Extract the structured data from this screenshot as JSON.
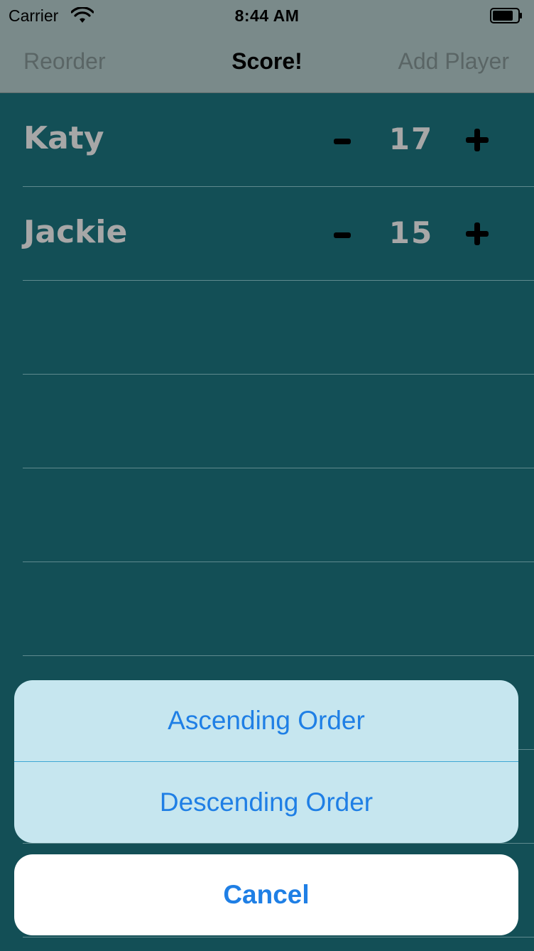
{
  "status_bar": {
    "carrier": "Carrier",
    "time": "8:44 AM",
    "icons": [
      "wifi-icon",
      "battery-icon"
    ]
  },
  "nav": {
    "left": "Reorder",
    "title": "Score!",
    "right": "Add Player"
  },
  "players": [
    {
      "name": "Katy",
      "score": "17",
      "minus": "−",
      "plus": "+"
    },
    {
      "name": "Jackie",
      "score": "15",
      "minus": "−",
      "plus": "+"
    }
  ],
  "action_sheet": {
    "options": [
      "Ascending Order",
      "Descending Order"
    ],
    "cancel": "Cancel"
  },
  "colors": {
    "background": "#134f56",
    "nav": "#7a8a8a",
    "sheet": "#c6e6ef",
    "action_text": "#1f7fe5"
  }
}
